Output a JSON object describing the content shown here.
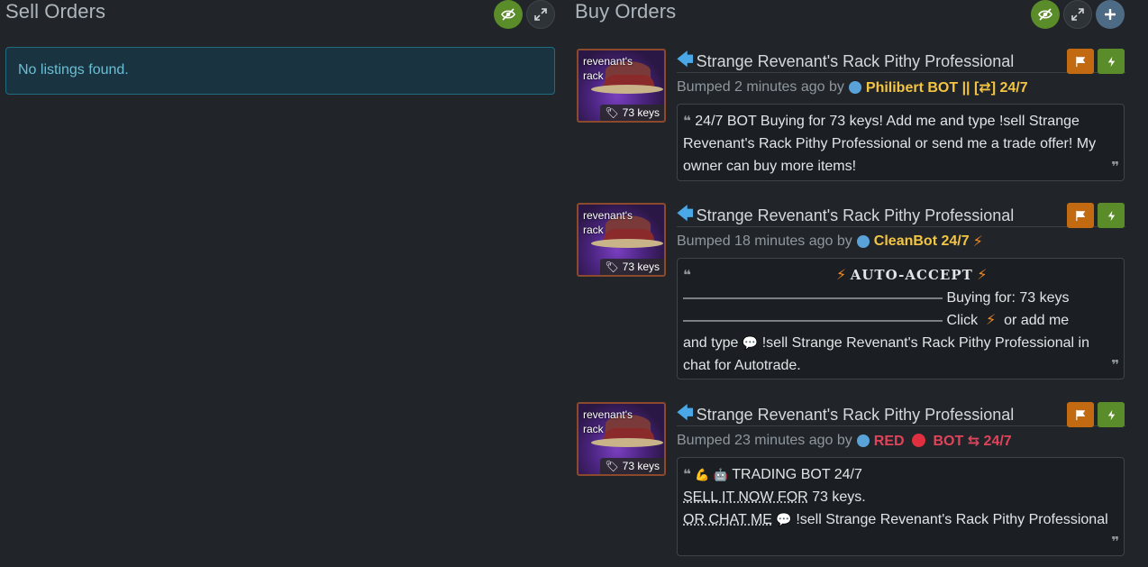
{
  "sell": {
    "title": "Sell Orders",
    "empty_text": "No listings found."
  },
  "buy": {
    "title": "Buy Orders"
  },
  "orders": [
    {
      "thumb_name": "revenant's rack",
      "price": "73 keys",
      "title": "Strange Revenant's Rack Pithy Professional",
      "bumped": "Bumped 2 minutes ago by",
      "user": "Philibert BOT || [⇄] 24/7",
      "user_color": "#f4c542",
      "message": "24/7 BOT Buying for 73 keys! Add me and type !sell Strange Revenant's Rack Pithy Professional or send me a trade offer! My owner can buy more items!"
    },
    {
      "thumb_name": "revenant's rack",
      "price": "73 keys",
      "title": "Strange Revenant's Rack Pithy Professional",
      "bumped": "Bumped 18 minutes ago by",
      "user": "CleanBot 24/7",
      "user_color": "#f4c542",
      "heading": "AUTO-ACCEPT",
      "line1_rule": "——————————————————",
      "line1_text": "Buying for: 73 keys",
      "line2_rule": "——————————————————",
      "line2_text_a": "Click",
      "line2_text_b": "or add me",
      "line3_a": "and type",
      "line3_b": "!sell Strange Revenant's Rack Pithy Professional in chat for Autotrade."
    },
    {
      "thumb_name": "revenant's rack",
      "price": "73 keys",
      "title": "Strange Revenant's Rack Pithy Professional",
      "bumped": "Bumped 23 minutes ago by",
      "user_a": "RED",
      "user_b": "BOT ⇆ 24/7",
      "user_color": "#e0445a",
      "line1": "TRADING BOT 24/7",
      "line2_a": "SELL IT NOW FOR",
      "line2_b": "73 keys.",
      "line3_a": "OR CHAT ME",
      "line3_b": "!sell Strange Revenant's Rack Pithy Professional"
    }
  ]
}
